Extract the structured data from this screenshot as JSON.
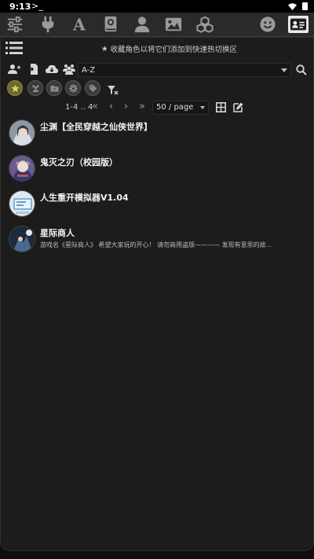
{
  "statusbar": {
    "time": "9:13",
    "term_glyph": ">_"
  },
  "topnav": {
    "icons": [
      "sliders-icon",
      "plug-icon",
      "font-icon",
      "book-atlas-icon",
      "user-icon",
      "image-icon",
      "cubes-icon",
      "smiley-icon",
      "address-card-icon"
    ],
    "active": "address-card-icon"
  },
  "hint": {
    "star": "★",
    "text": "收藏角色以将它们添加到快速热切换区"
  },
  "sort": {
    "value": "A-Z"
  },
  "pagination": {
    "range": "1-4 .. 4",
    "first": "«",
    "prev": "‹",
    "next": "›",
    "last": "»",
    "per_page": "50 / page"
  },
  "characters": [
    {
      "name": "尘渊【全民穿越之仙侠世界】",
      "desc": ""
    },
    {
      "name": "鬼灭之刃（校园版）",
      "desc": ""
    },
    {
      "name": "人生重开模拟器V1.04",
      "desc": ""
    },
    {
      "name": "星际商人",
      "desc": "游戏名《星际商人》 希望大家玩的开心！ 请勿商用盗版———— 发现有意思的故..."
    }
  ],
  "colors": {
    "background": "#0e0e0e",
    "panel": "#1c1c1c",
    "nav": "#2a2a2a",
    "fav": "#6e6a2a"
  }
}
